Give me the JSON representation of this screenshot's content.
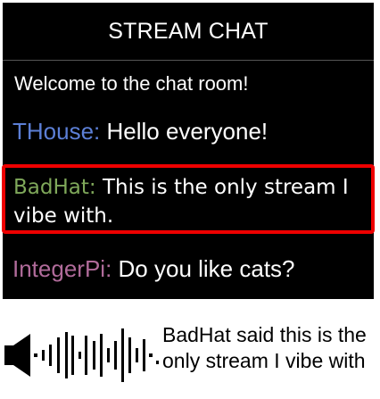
{
  "chat": {
    "title": "STREAM CHAT",
    "welcome": "Welcome to the chat room!",
    "messages": [
      {
        "user": "THouse:",
        "text": " Hello everyone!"
      },
      {
        "user": "BadHat:",
        "text": " This is the only stream I vibe with."
      },
      {
        "user": "IntegerPi:",
        "text": " Do you like cats?"
      }
    ]
  },
  "tts": {
    "icon": "speaker-waveform-icon",
    "caption": "BadHat said this is the only stream I vibe with"
  },
  "colors": {
    "chat_bg": "#000000",
    "highlight_border": "#ee0000",
    "user_thouse": "#5c7fd6",
    "user_badhat": "#7fa85a",
    "user_integerpi": "#b06b9a"
  }
}
